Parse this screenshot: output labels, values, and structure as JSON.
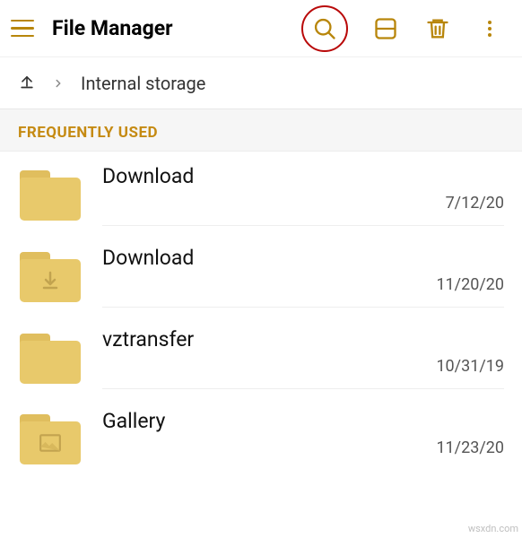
{
  "header": {
    "title": "File Manager"
  },
  "breadcrumb": {
    "location": "Internal storage"
  },
  "section": {
    "title": "FREQUENTLY USED"
  },
  "items": [
    {
      "name": "Download",
      "date": "7/12/20",
      "icon": "folder"
    },
    {
      "name": "Download",
      "date": "11/20/20",
      "icon": "download"
    },
    {
      "name": "vztransfer",
      "date": "10/31/19",
      "icon": "folder"
    },
    {
      "name": "Gallery",
      "date": "11/23/20",
      "icon": "image"
    }
  ],
  "watermark": "wsxdn.com",
  "colors": {
    "accent": "#c58a12",
    "highlight": "#b90909",
    "folder": "#e8c96b"
  }
}
